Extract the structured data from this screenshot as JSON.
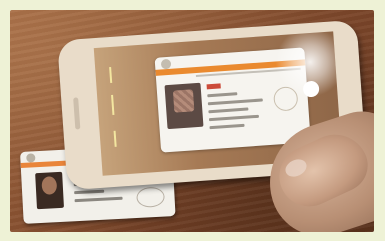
{
  "scene": {
    "subject": "phone-scanning-id-card",
    "colors": {
      "table": "#8a5332",
      "card_band": "#e9853a",
      "phone_body": "#e9dcc9",
      "scan_line": "#f3e6a0"
    }
  }
}
